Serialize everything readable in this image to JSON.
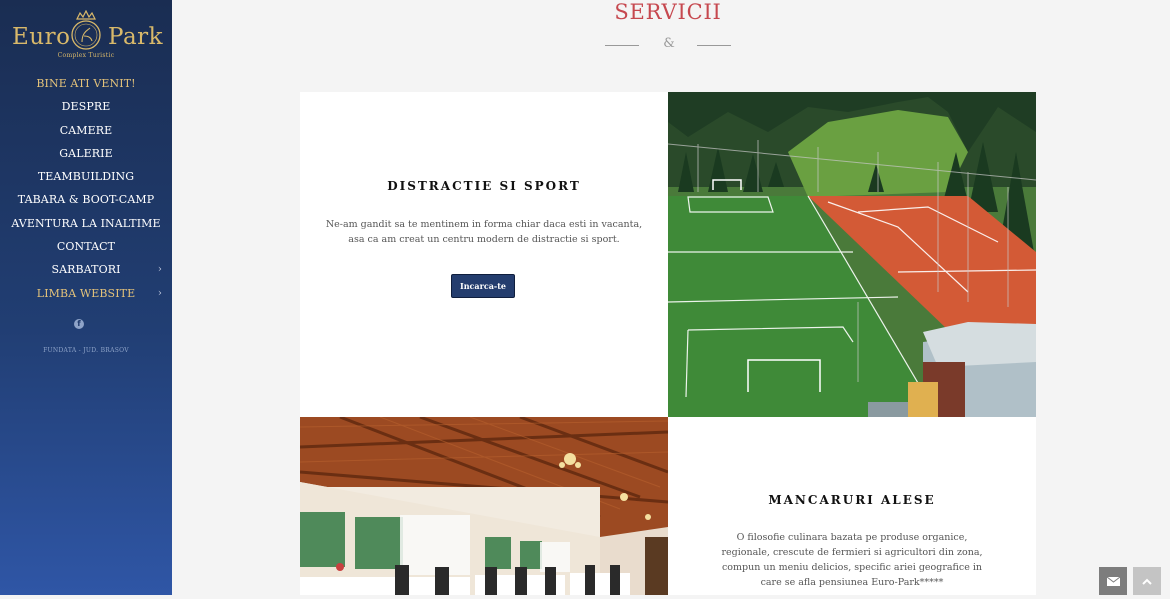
{
  "brand": {
    "word1": "Euro",
    "word2": "Park",
    "tagline": "Complex Turistic",
    "colors": {
      "gold": "#d9b96a",
      "sidebar": "#213e73"
    }
  },
  "nav": {
    "items": [
      {
        "label": "BINE ATI VENIT!"
      },
      {
        "label": "DESPRE"
      },
      {
        "label": "CAMERE"
      },
      {
        "label": "GALERIE"
      },
      {
        "label": "TEAMBUILDING"
      },
      {
        "label": "TABARA & BOOT-CAMP"
      },
      {
        "label": "AVENTURA LA INALTIME"
      },
      {
        "label": "CONTACT"
      },
      {
        "label": "SARBATORI"
      },
      {
        "label": "LIMBA WEBSITE"
      }
    ],
    "submenu_icon": "chevron-right-icon"
  },
  "social": {
    "icon": "facebook-icon",
    "glyph": "f"
  },
  "address": "FUNDATA - JUD. BRASOV",
  "section": {
    "title": "SERVICII",
    "ornament": "&",
    "title_color": "#c6484f"
  },
  "cards": [
    {
      "heading": "DISTRACTIE SI SPORT",
      "text": "Ne-am gandit sa te mentinem in forma chiar daca esti in vacanta, asa ca am creat un centru modern de distractie si sport.",
      "button": "Incarca-te",
      "image": "sports-field-image"
    },
    {
      "heading": "MANCARURI ALESE",
      "text": "O filosofie culinara bazata pe produse organice, regionale, crescute de fermieri si agricultori din zona, compun un meniu delicios, specific ariei geografice in care se afla pensiunea Euro-Park*****",
      "image": "restaurant-image"
    }
  ],
  "floating_buttons": [
    {
      "icon": "envelope-icon"
    },
    {
      "icon": "chevron-up-icon"
    }
  ]
}
